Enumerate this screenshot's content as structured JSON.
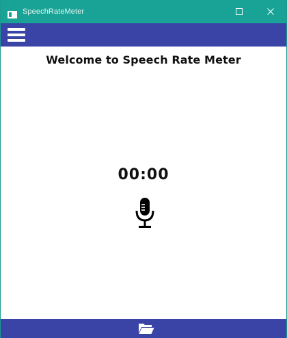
{
  "window": {
    "title": "SpeechRateMeter",
    "maximize_symbol": "☐",
    "close_symbol": "✕"
  },
  "toolbar": {
    "menu_icon": "hamburger-icon"
  },
  "main": {
    "welcome_text": "Welcome to Speech Rate Meter",
    "timer": "00:00",
    "mic_icon": "microphone-icon"
  },
  "bottombar": {
    "open_icon": "open-folder-icon"
  },
  "colors": {
    "titlebar": "#19a396",
    "toolbar": "#3a44a6",
    "background": "#ffffff",
    "text": "#111111"
  }
}
